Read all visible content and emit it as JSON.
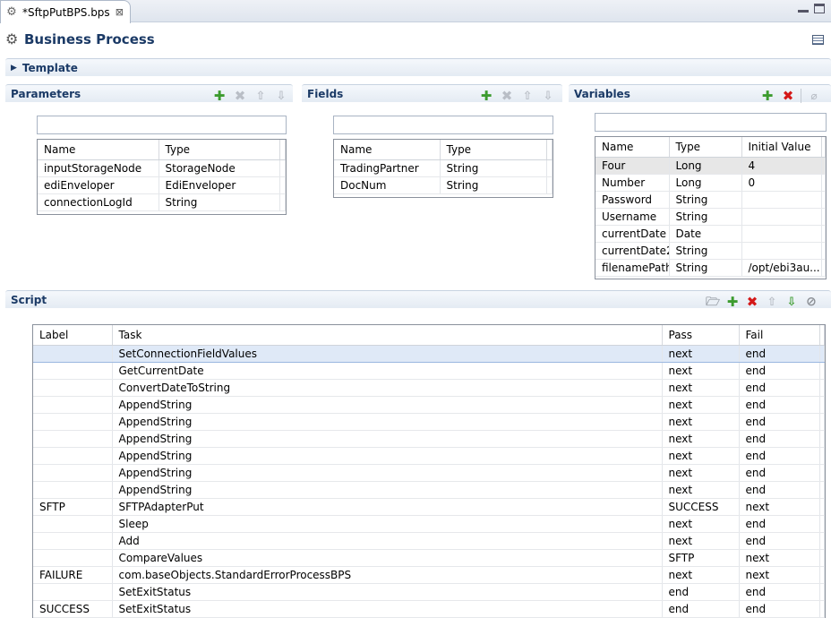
{
  "editor_tab": {
    "label": "*SftpPutBPS.bps",
    "close_glyph": "⊠"
  },
  "header": {
    "title": "Business Process"
  },
  "template_section": {
    "label": "Template"
  },
  "parameters": {
    "title": "Parameters",
    "columns": [
      "Name",
      "Type"
    ],
    "rows": [
      [
        "inputStorageNode",
        "StorageNode"
      ],
      [
        "ediEnveloper",
        "EdiEnveloper"
      ],
      [
        "connectionLogId",
        "String"
      ]
    ]
  },
  "fields": {
    "title": "Fields",
    "columns": [
      "Name",
      "Type"
    ],
    "rows": [
      [
        "TradingPartner",
        "String"
      ],
      [
        "DocNum",
        "String"
      ]
    ]
  },
  "variables": {
    "title": "Variables",
    "columns": [
      "Name",
      "Type",
      "Initial Value"
    ],
    "rows": [
      [
        "Four",
        "Long",
        "4"
      ],
      [
        "Number",
        "Long",
        "0"
      ],
      [
        "Password",
        "String",
        ""
      ],
      [
        "Username",
        "String",
        ""
      ],
      [
        "currentDate",
        "Date",
        ""
      ],
      [
        "currentDate2",
        "String",
        ""
      ],
      [
        "filenamePath",
        "String",
        "/opt/ebi3au..."
      ]
    ]
  },
  "script": {
    "title": "Script",
    "columns": [
      "Label",
      "Task",
      "Pass",
      "Fail"
    ],
    "rows": [
      [
        "",
        "SetConnectionFieldValues",
        "next",
        "end"
      ],
      [
        "",
        "GetCurrentDate",
        "next",
        "end"
      ],
      [
        "",
        "ConvertDateToString",
        "next",
        "end"
      ],
      [
        "",
        "AppendString",
        "next",
        "end"
      ],
      [
        "",
        "AppendString",
        "next",
        "end"
      ],
      [
        "",
        "AppendString",
        "next",
        "end"
      ],
      [
        "",
        "AppendString",
        "next",
        "end"
      ],
      [
        "",
        "AppendString",
        "next",
        "end"
      ],
      [
        "",
        "AppendString",
        "next",
        "end"
      ],
      [
        "SFTP",
        "SFTPAdapterPut",
        "SUCCESS",
        "next"
      ],
      [
        "",
        "Sleep",
        "next",
        "end"
      ],
      [
        "",
        "Add",
        "next",
        "end"
      ],
      [
        "",
        "CompareValues",
        "SFTP",
        "next"
      ],
      [
        "FAILURE",
        "com.baseObjects.StandardErrorProcessBPS",
        "next",
        "next"
      ],
      [
        "",
        "SetExitStatus",
        "end",
        "end"
      ],
      [
        "SUCCESS",
        "SetExitStatus",
        "end",
        "end"
      ]
    ]
  },
  "icons": {
    "tab": "process-gear-icon",
    "add": "green-plus-icon",
    "delete": "red-x-icon",
    "move_up": "arrow-up-icon",
    "move_down": "arrow-down-icon"
  },
  "colors": {
    "title": "#1b3a66",
    "add": "#3c9b2e",
    "delete": "#d41818",
    "selection": "#dfe9f7"
  }
}
